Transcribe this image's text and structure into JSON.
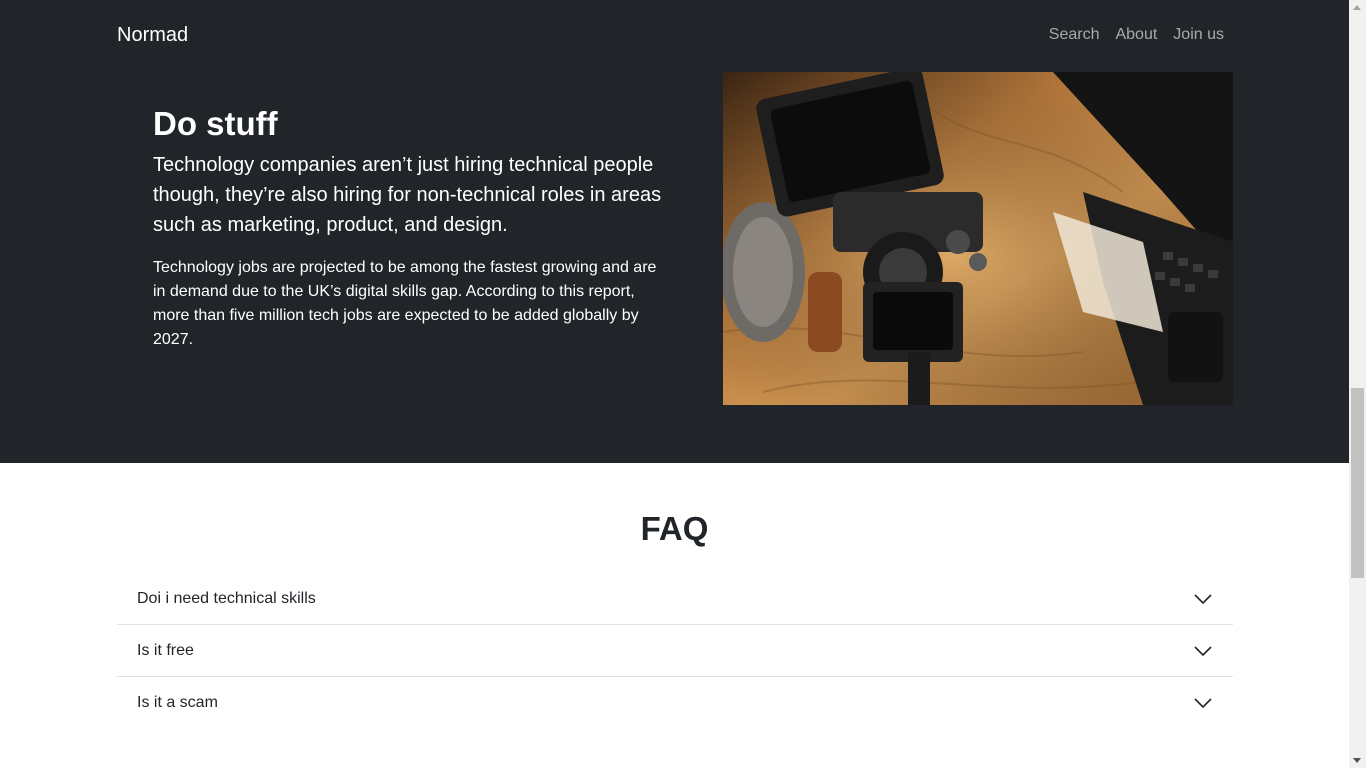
{
  "header": {
    "brand": "Normad",
    "nav": [
      "Search",
      "About",
      "Join us"
    ]
  },
  "hero": {
    "title": "Do stuff",
    "lead": "Technology companies aren’t just hiring technical people though, they’re also hiring for non-technical roles in areas such as marketing, product, and design.",
    "body": "Technology jobs are projected to be among the fastest growing and are in demand due to the UK’s digital skills gap. According to this report, more than five million tech jobs are expected to be added globally by 2027."
  },
  "faq": {
    "title": "FAQ",
    "items": [
      {
        "question": "Doi i need technical skills"
      },
      {
        "question": "Is it free"
      },
      {
        "question": "Is it a scam"
      }
    ]
  },
  "colors": {
    "hero_bg": "#212529",
    "text_dark": "#212529",
    "divider": "#dee2e6"
  }
}
